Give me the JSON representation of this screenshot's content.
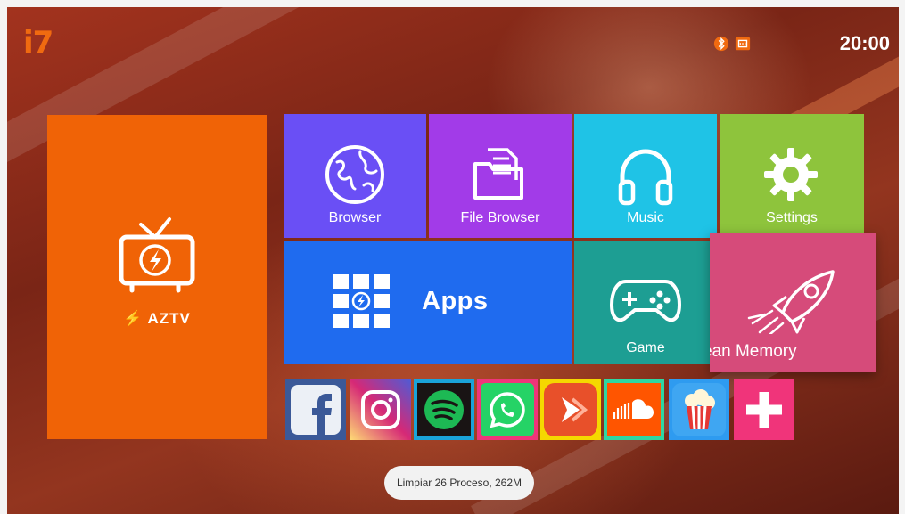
{
  "brand": "i7",
  "status_bar": {
    "time": "20:00",
    "icons": [
      "bluetooth-icon",
      "ethernet-icon"
    ]
  },
  "tiles": {
    "aztv": {
      "label": "AZTV",
      "color": "#f06306",
      "icon": "tv-lightning-icon"
    },
    "browser": {
      "label": "Browser",
      "color": "#6a4ff5",
      "icon": "globe-icon"
    },
    "file_browser": {
      "label": "File Browser",
      "color": "#a23be8",
      "icon": "folder-icon"
    },
    "music": {
      "label": "Music",
      "color": "#1fc3e6",
      "icon": "headphones-icon"
    },
    "settings": {
      "label": "Settings",
      "color": "#8ec43c",
      "icon": "gear-icon"
    },
    "apps": {
      "label": "Apps",
      "color": "#1f6bef",
      "icon": "apps-grid-icon"
    },
    "game": {
      "label": "Game",
      "color": "#1d9e93",
      "icon": "gamepad-icon"
    },
    "clean_memory": {
      "label": "ean Memory",
      "color": "#d64b7a",
      "icon": "rocket-icon"
    }
  },
  "app_row": [
    {
      "name": "facebook",
      "icon": "facebook-icon",
      "color": "#3b5998"
    },
    {
      "name": "instagram",
      "icon": "instagram-icon",
      "color": "#c13584"
    },
    {
      "name": "spotify",
      "icon": "spotify-icon",
      "color": "#1db954"
    },
    {
      "name": "whatsapp",
      "icon": "whatsapp-icon",
      "color": "#25d366"
    },
    {
      "name": "aptoide",
      "icon": "aptoide-icon",
      "color": "#e8502a"
    },
    {
      "name": "soundcloud",
      "icon": "soundcloud-icon",
      "color": "#ff5500"
    },
    {
      "name": "popcorn",
      "icon": "popcorn-icon",
      "color": "#2e9bf0"
    },
    {
      "name": "add-app",
      "icon": "plus-icon",
      "color": "#f0347a"
    }
  ],
  "toast": "Limpiar 26 Proceso, 262M"
}
